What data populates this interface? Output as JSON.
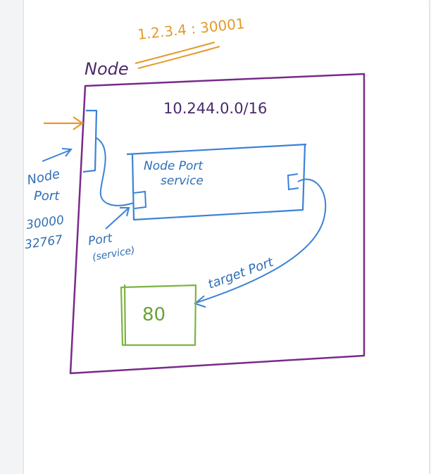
{
  "colors": {
    "node_box": "#7a2a8a",
    "service": "#3b82d6",
    "pod": "#7cb342",
    "annotation_orange": "#e39a2b",
    "text_dark": "#4a2a6b"
  },
  "diagram": {
    "node_label": "Node",
    "node_ip_port": "1.2.3.4 : 30001",
    "cluster_cidr": "10.244.0.0/16",
    "service_line1": "Node Port",
    "service_line2": "service",
    "nodeport_line1": "Node",
    "nodeport_line2": "Port",
    "nodeport_range_start": "30000",
    "nodeport_range_end": "32767",
    "port_line1": "Port",
    "port_line2": "(service)",
    "target_port": "target Port",
    "pod_port": "80"
  }
}
